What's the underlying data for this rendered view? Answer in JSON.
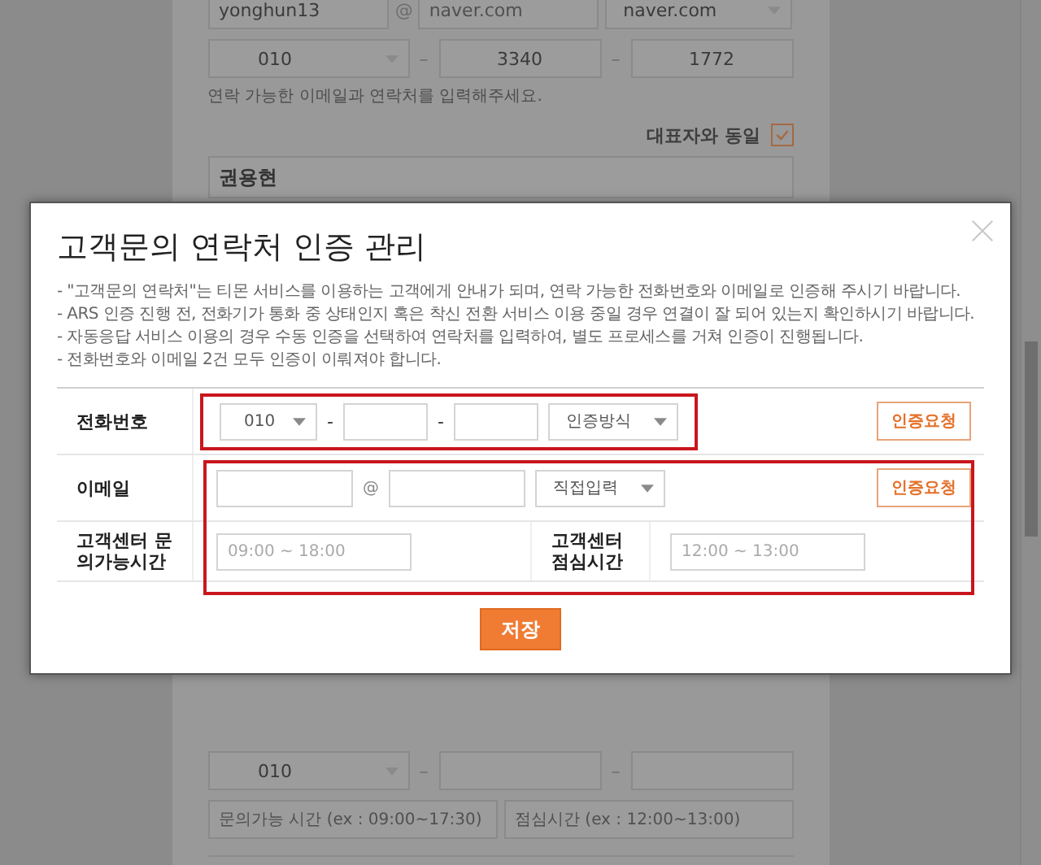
{
  "background_form": {
    "email": {
      "id": "yonghun13",
      "at": "@",
      "domain_placeholder": "naver.com",
      "domain_select": "naver.com"
    },
    "phone": {
      "prefix": "010",
      "dash_1": "–",
      "middle": "3340",
      "dash_2": "–",
      "last": "1772"
    },
    "helper_text": "연락 가능한 이메일과 연락처를 입력해주세요.",
    "same_as_representative": {
      "label": "대표자와 동일",
      "checked": true
    },
    "name_field": {
      "value": "권용현"
    },
    "lower_phone": {
      "prefix": "010",
      "dash_1": "–",
      "dash_2": "–"
    },
    "lower_hours": [
      {
        "placeholder": "문의가능 시간 (ex : 09:00~17:30)"
      },
      {
        "placeholder": "점심시간 (ex : 12:00~13:00)"
      }
    ]
  },
  "dialog": {
    "title": "고객문의 연락처 인증 관리",
    "notes": [
      "- \"고객문의 연락처\"는 티몬 서비스를 이용하는 고객에게 안내가 되며, 연락 가능한 전화번호와 이메일로 인증해 주시기 바랍니다.",
      "- ARS 인증 진행 전, 전화기가 통화 중 상태인지 혹은 착신 전환 서비스 이용 중일 경우 연결이 잘 되어 있는지 확인하시기 바랍니다.",
      "- 자동응답 서비스 이용의 경우 수동 인증을 선택하여 연락처를 입력하여, 별도 프로세스를 거쳐 인증이 진행됩니다.",
      "- 전화번호와 이메일 2건 모두 인증이 이뤄져야 합니다."
    ],
    "phone_row": {
      "label": "전화번호",
      "prefix_select": "010",
      "dash_1": "-",
      "dash_2": "-",
      "method_select": "인증방식",
      "request_button": "인증요청"
    },
    "email_row": {
      "label": "이메일",
      "at": "@",
      "domain_select": "직접입력",
      "request_button": "인증요청"
    },
    "hours_row": {
      "inquiry_label": "고객센터 문의가능시간",
      "inquiry_placeholder": "09:00 ~ 18:00",
      "lunch_label": "고객센터 점심시간",
      "lunch_placeholder": "12:00 ~ 13:00"
    },
    "save_button": "저장"
  }
}
